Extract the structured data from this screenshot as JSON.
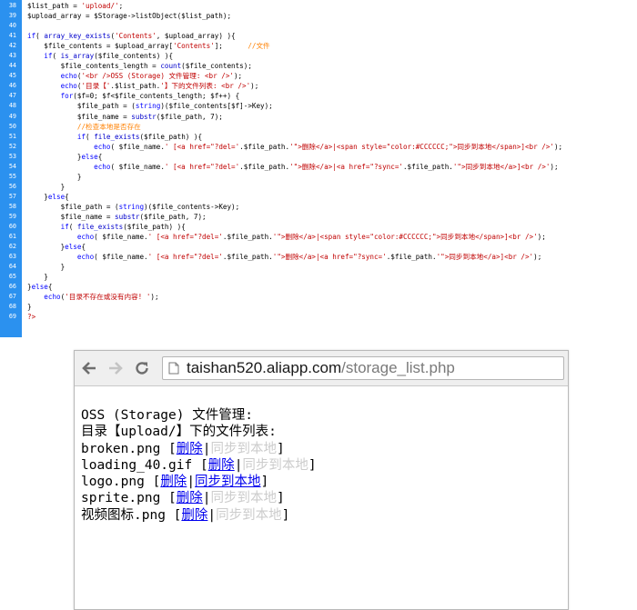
{
  "editor": {
    "lines": [
      {
        "n": "38",
        "segs": [
          [
            "var",
            "$list_path = "
          ],
          [
            "str",
            "'upload/'"
          ],
          [
            "var",
            ";"
          ]
        ]
      },
      {
        "n": "39",
        "segs": [
          [
            "var",
            "$upload_array = $Storage->listObject($list_path);"
          ]
        ]
      },
      {
        "n": "40",
        "segs": []
      },
      {
        "n": "41",
        "segs": [
          [
            "kw",
            "if"
          ],
          [
            "var",
            "( "
          ],
          [
            "fn",
            "array_key_exists"
          ],
          [
            "var",
            "("
          ],
          [
            "str",
            "'Contents'"
          ],
          [
            "var",
            ", $upload_array) ){"
          ]
        ]
      },
      {
        "n": "42",
        "segs": [
          [
            "var",
            "    $file_contents = $upload_array["
          ],
          [
            "str",
            "'Contents'"
          ],
          [
            "var",
            "];      "
          ],
          [
            "cm",
            "//文件"
          ]
        ]
      },
      {
        "n": "43",
        "segs": [
          [
            "var",
            "    "
          ],
          [
            "kw",
            "if"
          ],
          [
            "var",
            "( "
          ],
          [
            "fn",
            "is_array"
          ],
          [
            "var",
            "($file_contents) ){"
          ]
        ]
      },
      {
        "n": "44",
        "segs": [
          [
            "var",
            "        $file_contents_length = "
          ],
          [
            "fn",
            "count"
          ],
          [
            "var",
            "($file_contents);"
          ]
        ]
      },
      {
        "n": "45",
        "segs": [
          [
            "var",
            "        "
          ],
          [
            "kw",
            "echo"
          ],
          [
            "var",
            "("
          ],
          [
            "str",
            "'<br />OSS (Storage) 文件管理: <br />'"
          ],
          [
            "var",
            ");"
          ]
        ]
      },
      {
        "n": "46",
        "segs": [
          [
            "var",
            "        "
          ],
          [
            "kw",
            "echo"
          ],
          [
            "var",
            "("
          ],
          [
            "str",
            "'目录【'"
          ],
          [
            "var",
            ".$list_path."
          ],
          [
            "str",
            "'】下的文件列表: <br />'"
          ],
          [
            "var",
            ");"
          ]
        ]
      },
      {
        "n": "47",
        "segs": [
          [
            "var",
            "        "
          ],
          [
            "kw",
            "for"
          ],
          [
            "var",
            "($f=0; $f<$file_contents_length; $f++) {"
          ]
        ]
      },
      {
        "n": "48",
        "segs": [
          [
            "var",
            "            $file_path = ("
          ],
          [
            "kw",
            "string"
          ],
          [
            "var",
            ")($file_contents[$f]->Key);"
          ]
        ]
      },
      {
        "n": "49",
        "segs": [
          [
            "var",
            "            $file_name = "
          ],
          [
            "fn",
            "substr"
          ],
          [
            "var",
            "($file_path, 7);"
          ]
        ]
      },
      {
        "n": "50",
        "segs": [
          [
            "var",
            "            "
          ],
          [
            "cm",
            "//检查本地是否存在"
          ]
        ]
      },
      {
        "n": "51",
        "segs": [
          [
            "var",
            "            "
          ],
          [
            "kw",
            "if"
          ],
          [
            "var",
            "( "
          ],
          [
            "fn",
            "file_exists"
          ],
          [
            "var",
            "($file_path) ){"
          ]
        ]
      },
      {
        "n": "52",
        "segs": [
          [
            "var",
            "                "
          ],
          [
            "kw",
            "echo"
          ],
          [
            "var",
            "( $file_name."
          ],
          [
            "str",
            "' [<a href=\"?del='"
          ],
          [
            "var",
            ".$file_path."
          ],
          [
            "str",
            "'\">删除</a>|<span style=\"color:#CCCCCC;\">同步到本地</span>]<br />'"
          ],
          [
            "var",
            ");"
          ]
        ]
      },
      {
        "n": "53",
        "segs": [
          [
            "var",
            "            }"
          ],
          [
            "kw",
            "else"
          ],
          [
            "var",
            "{"
          ]
        ]
      },
      {
        "n": "54",
        "segs": [
          [
            "var",
            "                "
          ],
          [
            "kw",
            "echo"
          ],
          [
            "var",
            "( $file_name."
          ],
          [
            "str",
            "' [<a href=\"?del='"
          ],
          [
            "var",
            ".$file_path."
          ],
          [
            "str",
            "'\">删除</a>|<a href=\"?sync='"
          ],
          [
            "var",
            ".$file_path."
          ],
          [
            "str",
            "'\">同步到本地</a>]<br />'"
          ],
          [
            "var",
            ");"
          ]
        ]
      },
      {
        "n": "55",
        "segs": [
          [
            "var",
            "            }"
          ]
        ]
      },
      {
        "n": "56",
        "segs": [
          [
            "var",
            "        }"
          ]
        ]
      },
      {
        "n": "57",
        "segs": [
          [
            "var",
            "    }"
          ],
          [
            "kw",
            "else"
          ],
          [
            "var",
            "{"
          ]
        ]
      },
      {
        "n": "58",
        "segs": [
          [
            "var",
            "        $file_path = ("
          ],
          [
            "kw",
            "string"
          ],
          [
            "var",
            ")($file_contents->Key);"
          ]
        ]
      },
      {
        "n": "59",
        "segs": [
          [
            "var",
            "        $file_name = "
          ],
          [
            "fn",
            "substr"
          ],
          [
            "var",
            "($file_path, 7);"
          ]
        ]
      },
      {
        "n": "60",
        "segs": [
          [
            "var",
            "        "
          ],
          [
            "kw",
            "if"
          ],
          [
            "var",
            "( "
          ],
          [
            "fn",
            "file_exists"
          ],
          [
            "var",
            "($file_path) ){"
          ]
        ]
      },
      {
        "n": "61",
        "segs": [
          [
            "var",
            "            "
          ],
          [
            "kw",
            "echo"
          ],
          [
            "var",
            "( $file_name."
          ],
          [
            "str",
            "' [<a href=\"?del='"
          ],
          [
            "var",
            ".$file_path."
          ],
          [
            "str",
            "'\">删除</a>|<span style=\"color:#CCCCCC;\">同步到本地</span>]<br />'"
          ],
          [
            "var",
            ");"
          ]
        ]
      },
      {
        "n": "62",
        "segs": [
          [
            "var",
            "        }"
          ],
          [
            "kw",
            "else"
          ],
          [
            "var",
            "{"
          ]
        ]
      },
      {
        "n": "63",
        "segs": [
          [
            "var",
            "            "
          ],
          [
            "kw",
            "echo"
          ],
          [
            "var",
            "( $file_name."
          ],
          [
            "str",
            "' [<a href=\"?del='"
          ],
          [
            "var",
            ".$file_path."
          ],
          [
            "str",
            "'\">删除</a>|<a href=\"?sync='"
          ],
          [
            "var",
            ".$file_path."
          ],
          [
            "str",
            "'\">同步到本地</a>]<br />'"
          ],
          [
            "var",
            ");"
          ]
        ]
      },
      {
        "n": "64",
        "segs": [
          [
            "var",
            "        }"
          ]
        ]
      },
      {
        "n": "65",
        "segs": [
          [
            "var",
            "    }"
          ]
        ]
      },
      {
        "n": "66",
        "segs": [
          [
            "var",
            "}"
          ],
          [
            "kw",
            "else"
          ],
          [
            "var",
            "{"
          ]
        ]
      },
      {
        "n": "67",
        "segs": [
          [
            "var",
            "    "
          ],
          [
            "kw",
            "echo"
          ],
          [
            "var",
            "("
          ],
          [
            "str",
            "'目录不存在或没有内容! '"
          ],
          [
            "var",
            ");"
          ]
        ]
      },
      {
        "n": "68",
        "segs": [
          [
            "var",
            "}"
          ]
        ]
      },
      {
        "n": "69",
        "segs": [
          [
            "str",
            "?>"
          ]
        ]
      }
    ],
    "colors": {
      "gutter": "#2b91ef",
      "string": "#c00000",
      "function": "#0000cc",
      "keyword": "#0000ff",
      "comment": "#ff8000"
    }
  },
  "browser": {
    "url_host": "taishan520.aliapp.com",
    "url_path": "/storage_list.php",
    "icons": {
      "back": "back-arrow-icon",
      "forward": "forward-arrow-icon",
      "reload": "reload-icon",
      "page": "page-icon"
    },
    "heading1": "OSS (Storage) 文件管理:",
    "heading2": "目录【upload/】下的文件列表:",
    "files": [
      {
        "name": "broken.png",
        "delete_label": "删除",
        "sync_label": "同步到本地",
        "synced": true
      },
      {
        "name": "loading_40.gif",
        "delete_label": "删除",
        "sync_label": "同步到本地",
        "synced": true
      },
      {
        "name": "logo.png",
        "delete_label": "删除",
        "sync_label": "同步到本地",
        "synced": false
      },
      {
        "name": "sprite.png",
        "delete_label": "删除",
        "sync_label": "同步到本地",
        "synced": true
      },
      {
        "name": "视频图标.png",
        "delete_label": "删除",
        "sync_label": "同步到本地",
        "synced": true
      }
    ],
    "link_color": "#0000ee",
    "disabled_color": "#cccccc"
  }
}
